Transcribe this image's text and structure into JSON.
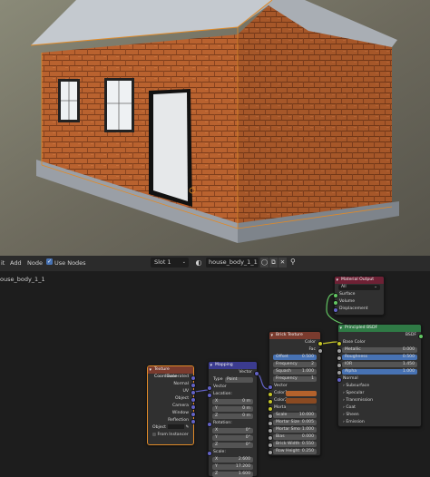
{
  "header": {
    "menu": [
      "it",
      "Add",
      "Node"
    ],
    "use_nodes": "Use Nodes",
    "slot": "Slot 1",
    "material_name": "house_body_1_1"
  },
  "breadcrumb": "ouse_body_1_1",
  "nodes": {
    "texcoord": {
      "title": "Texture Coordinate",
      "outputs": [
        "Generated",
        "Normal",
        "UV",
        "Object",
        "Camera",
        "Window",
        "Reflection"
      ],
      "object_label": "Object",
      "from_instancer": "From Instancer"
    },
    "mapping": {
      "title": "Mapping",
      "out_vector": "Vector",
      "type_label": "Type",
      "type_value": "Point",
      "in_vector": "Vector",
      "location": "Location:",
      "rotation": "Rotation:",
      "scale": "Scale:",
      "loc": [
        [
          "X",
          "0 m"
        ],
        [
          "Y",
          "0 m"
        ],
        [
          "Z",
          "0 m"
        ]
      ],
      "rot": [
        [
          "X",
          "0°"
        ],
        [
          "Y",
          "0°"
        ],
        [
          "Z",
          "0°"
        ]
      ],
      "scl": [
        [
          "X",
          "2.600"
        ],
        [
          "Y",
          "17.200"
        ],
        [
          "Z",
          "1.600"
        ]
      ]
    },
    "brick": {
      "title": "Brick Texture",
      "out_color": "Color",
      "out_fac": "Fac",
      "offset": [
        "Offset",
        "0.500"
      ],
      "frequency1": [
        "Frequency",
        "2"
      ],
      "squash": [
        "Squash",
        "1.000"
      ],
      "frequency2": [
        "Frequency",
        "1"
      ],
      "in_vector": "Vector",
      "color1": "Color1",
      "color2": "Color2",
      "mortar": "Mortar",
      "scale": [
        "Scale",
        "10.000"
      ],
      "mortar_size": [
        "Mortar Size",
        "0.005"
      ],
      "mortar_smooth": [
        "Mortar Smo",
        "1.000"
      ],
      "bias": [
        "Bias",
        "0.000"
      ],
      "brick_width": [
        "Brick Width",
        "0.550"
      ],
      "row_height": [
        "Row Height",
        "0.250"
      ]
    },
    "bsdf": {
      "title": "Principled BSDF",
      "out": "BSDF",
      "base_color": "Base Color",
      "metallic": [
        "Metallic",
        "0.000"
      ],
      "roughness": [
        "Roughness",
        "0.500"
      ],
      "ior": [
        "IOR",
        "1.450"
      ],
      "alpha": [
        "Alpha",
        "1.000"
      ],
      "normal": "Normal",
      "panels": [
        "Subsurface",
        "Specular",
        "Transmission",
        "Coat",
        "Sheen",
        "Emission"
      ]
    },
    "matout": {
      "title": "Material Output",
      "target": "All",
      "surface": "Surface",
      "volume": "Volume",
      "displacement": "Displacement"
    }
  },
  "colors": {
    "brick_color1": "#b4622c",
    "brick_color2": "#8a4a22",
    "mortar": "#3a3a3a",
    "node_texture_header": "#7a3b2e",
    "node_vector_header": "#3b3b8f",
    "node_shader_header": "#2f7a45",
    "node_output_header": "#6e2135",
    "selection": "#e08a28"
  }
}
